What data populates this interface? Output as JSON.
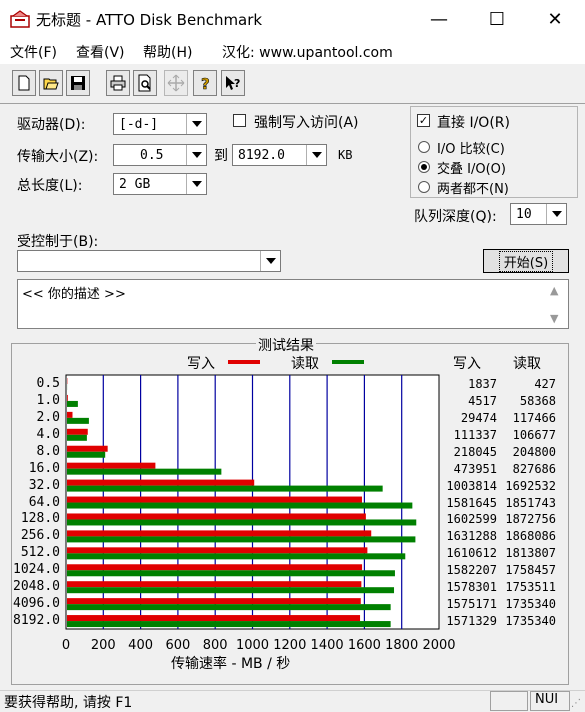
{
  "window": {
    "title": "无标题 - ATTO Disk Benchmark",
    "minimize": "—",
    "maximize": "☐",
    "close": "✕"
  },
  "menu": [
    "文件(F)",
    "查看(V)",
    "帮助(H)",
    "汉化: www.upantool.com"
  ],
  "toolbar": [
    "new-icon",
    "open-icon",
    "save-icon",
    "print-icon",
    "print-preview-icon",
    "move-icon",
    "help-icon",
    "context-help-icon"
  ],
  "form": {
    "drive_label": "驱动器(D):",
    "drive_value": "[-d-]",
    "transfer_label": "传输大小(Z):",
    "transfer_from": "0.5",
    "to_label": "到",
    "transfer_to": "8192.0",
    "kb_label": "KB",
    "length_label": "总长度(L):",
    "length_value": "2 GB",
    "force_write_label": "强制写入访问(A)",
    "direct_io_label": "直接 I/O(R)",
    "io_compare_label": "I/O 比较(C)",
    "overlap_io_label": "交叠 I/O(O)",
    "neither_label": "两者都不(N)",
    "queue_label": "队列深度(Q):",
    "queue_value": "10",
    "controlled_label": "受控制于(B):",
    "controlled_value": "",
    "start_button": "开始(S)",
    "description": "<<  你的描述   >>"
  },
  "results": {
    "title": "测试结果",
    "legend_write": "写入",
    "legend_read": "读取",
    "col_write": "写入",
    "col_read": "读取",
    "xlabel": "传输速率 - MB / 秒"
  },
  "colors": {
    "write": "#e00000",
    "read": "#008000",
    "grid": "#0000a0"
  },
  "chart_data": {
    "type": "bar",
    "orientation": "horizontal",
    "categories": [
      "0.5",
      "1.0",
      "2.0",
      "4.0",
      "8.0",
      "16.0",
      "32.0",
      "64.0",
      "128.0",
      "256.0",
      "512.0",
      "1024.0",
      "2048.0",
      "4096.0",
      "8192.0"
    ],
    "series": [
      {
        "name": "写入",
        "values": [
          1837,
          4517,
          29474,
          111337,
          218045,
          473951,
          1003814,
          1581645,
          1602599,
          1631288,
          1610612,
          1582207,
          1578301,
          1575171,
          1571329
        ]
      },
      {
        "name": "读取",
        "values": [
          427,
          58368,
          117466,
          106677,
          204800,
          827686,
          1692532,
          1851743,
          1872756,
          1868086,
          1813807,
          1758457,
          1753511,
          1735340,
          1735340
        ]
      }
    ],
    "value_unit_divisor": 1000,
    "xticks": [
      "0",
      "200",
      "400",
      "600",
      "800",
      "1000",
      "1200",
      "1400",
      "1600",
      "1800",
      "2000"
    ],
    "xlim": [
      0,
      2000
    ],
    "xlabel": "传输速率 - MB / 秒",
    "grid": true,
    "legend": "top"
  },
  "status": {
    "text": "要获得帮助, 请按 F1",
    "panel2": "",
    "panel3": "NUI"
  }
}
